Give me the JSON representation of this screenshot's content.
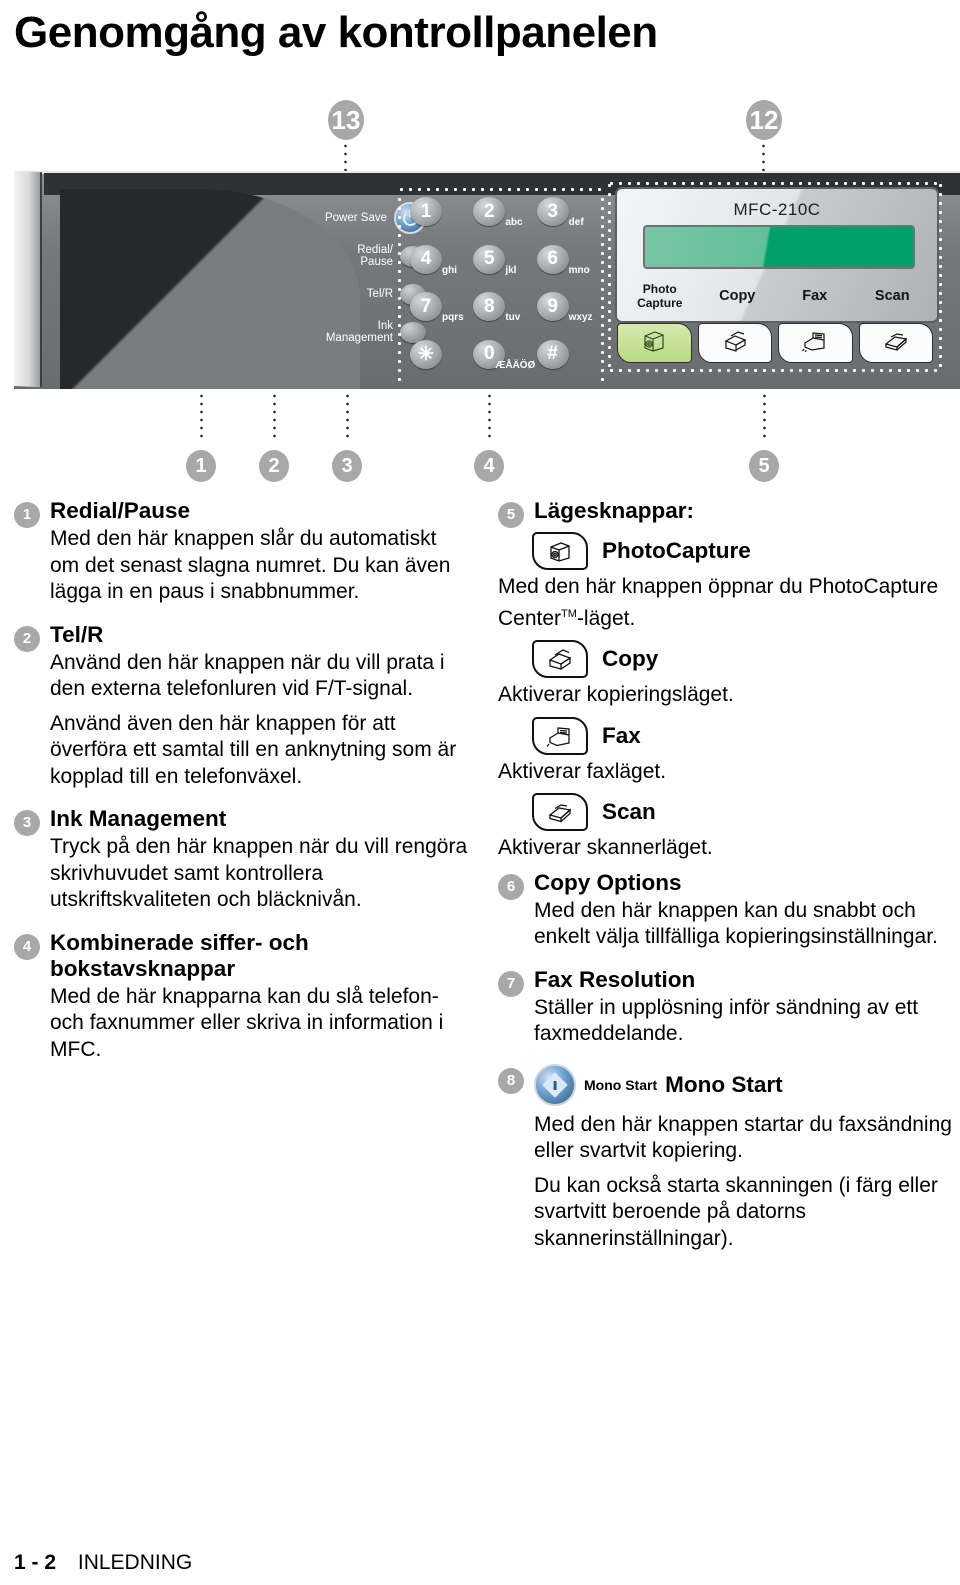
{
  "page": {
    "title": "Genomgång av kontrollpanelen",
    "footer_page": "1 - 2",
    "footer_section": "INLEDNING"
  },
  "top_callouts": [
    {
      "number": "13"
    },
    {
      "number": "12"
    }
  ],
  "bottom_callouts": [
    {
      "number": "1"
    },
    {
      "number": "2"
    },
    {
      "number": "3"
    },
    {
      "number": "4"
    },
    {
      "number": "5"
    }
  ],
  "panel": {
    "side_buttons": [
      {
        "label": "Power Save",
        "icon": "power-icon"
      },
      {
        "label": "Redial/\nPause",
        "icon": "round-button"
      },
      {
        "label": "Tel/R",
        "icon": "round-button"
      },
      {
        "label": "Ink\nManagement",
        "icon": "round-button"
      }
    ],
    "keypad": [
      {
        "digit": "1",
        "letters": ""
      },
      {
        "digit": "2",
        "letters": "abc"
      },
      {
        "digit": "3",
        "letters": "def"
      },
      {
        "digit": "4",
        "letters": "ghi"
      },
      {
        "digit": "5",
        "letters": "jkl"
      },
      {
        "digit": "6",
        "letters": "mno"
      },
      {
        "digit": "7",
        "letters": "pqrs"
      },
      {
        "digit": "8",
        "letters": "tuv"
      },
      {
        "digit": "9",
        "letters": "wxyz"
      },
      {
        "digit": "✳",
        "letters": ""
      },
      {
        "digit": "0",
        "letters": "ÆÅÄÖØ"
      },
      {
        "digit": "#",
        "letters": ""
      }
    ],
    "lcd": {
      "model": "MFC-210C",
      "screen_color": "#00a06a"
    },
    "mode_labels": [
      {
        "label": "Photo\nCapture",
        "icon": "photocapture-icon"
      },
      {
        "label": "Copy",
        "icon": "copy-icon"
      },
      {
        "label": "Fax",
        "icon": "fax-icon"
      },
      {
        "label": "Scan",
        "icon": "scan-icon"
      }
    ]
  },
  "left_column": [
    {
      "number": "1",
      "heading": "Redial/Pause",
      "paragraphs": [
        "Med den här knappen slår du automatiskt om det senast slagna numret. Du kan även lägga in en paus i snabbnummer."
      ]
    },
    {
      "number": "2",
      "heading": "Tel/R",
      "paragraphs": [
        "Använd den här knappen när du vill prata i den externa telefonluren vid F/T-signal.",
        "Använd även den här knappen för att överföra ett samtal till en anknytning som är kopplad till en telefonväxel."
      ]
    },
    {
      "number": "3",
      "heading": "Ink Management",
      "paragraphs": [
        "Tryck på den här knappen när du vill rengöra skrivhuvudet samt kontrollera utskriftskvaliteten och bläcknivån."
      ]
    },
    {
      "number": "4",
      "heading": "Kombinerade siffer- och bokstavsknappar",
      "paragraphs": [
        "Med de här knapparna kan du slå telefon- och faxnummer eller skriva in information i MFC."
      ]
    }
  ],
  "right_column": {
    "item5": {
      "number": "5",
      "heading": "Lägesknappar:",
      "modes": [
        {
          "icon": "photocapture-icon",
          "name": "PhotoCapture",
          "description_pre": "Med den här knappen öppnar du PhotoCapture Center",
          "description_tm": "TM",
          "description_post": "-läget."
        },
        {
          "icon": "copy-icon",
          "name": "Copy",
          "description_pre": "Aktiverar kopieringsläget.",
          "description_tm": "",
          "description_post": ""
        },
        {
          "icon": "fax-icon",
          "name": "Fax",
          "description_pre": "Aktiverar faxläget.",
          "description_tm": "",
          "description_post": ""
        },
        {
          "icon": "scan-icon",
          "name": "Scan",
          "description_pre": "Aktiverar skannerläget.",
          "description_tm": "",
          "description_post": ""
        }
      ]
    },
    "items": [
      {
        "number": "6",
        "heading": "Copy Options",
        "paragraphs": [
          "Med den här knappen kan du snabbt och enkelt välja tillfälliga kopieringsinställningar."
        ]
      },
      {
        "number": "7",
        "heading": "Fax Resolution",
        "paragraphs": [
          "Ställer in upplösning inför sändning av ett faxmeddelande."
        ]
      }
    ],
    "item8": {
      "number": "8",
      "button_small_label": "Mono Start",
      "heading": "Mono Start",
      "paragraphs": [
        "Med den här knappen startar du faxsändning eller svartvit kopiering.",
        "Du kan också starta skanningen (i färg eller svartvitt beroende på datorns skannerinställningar)."
      ]
    }
  }
}
